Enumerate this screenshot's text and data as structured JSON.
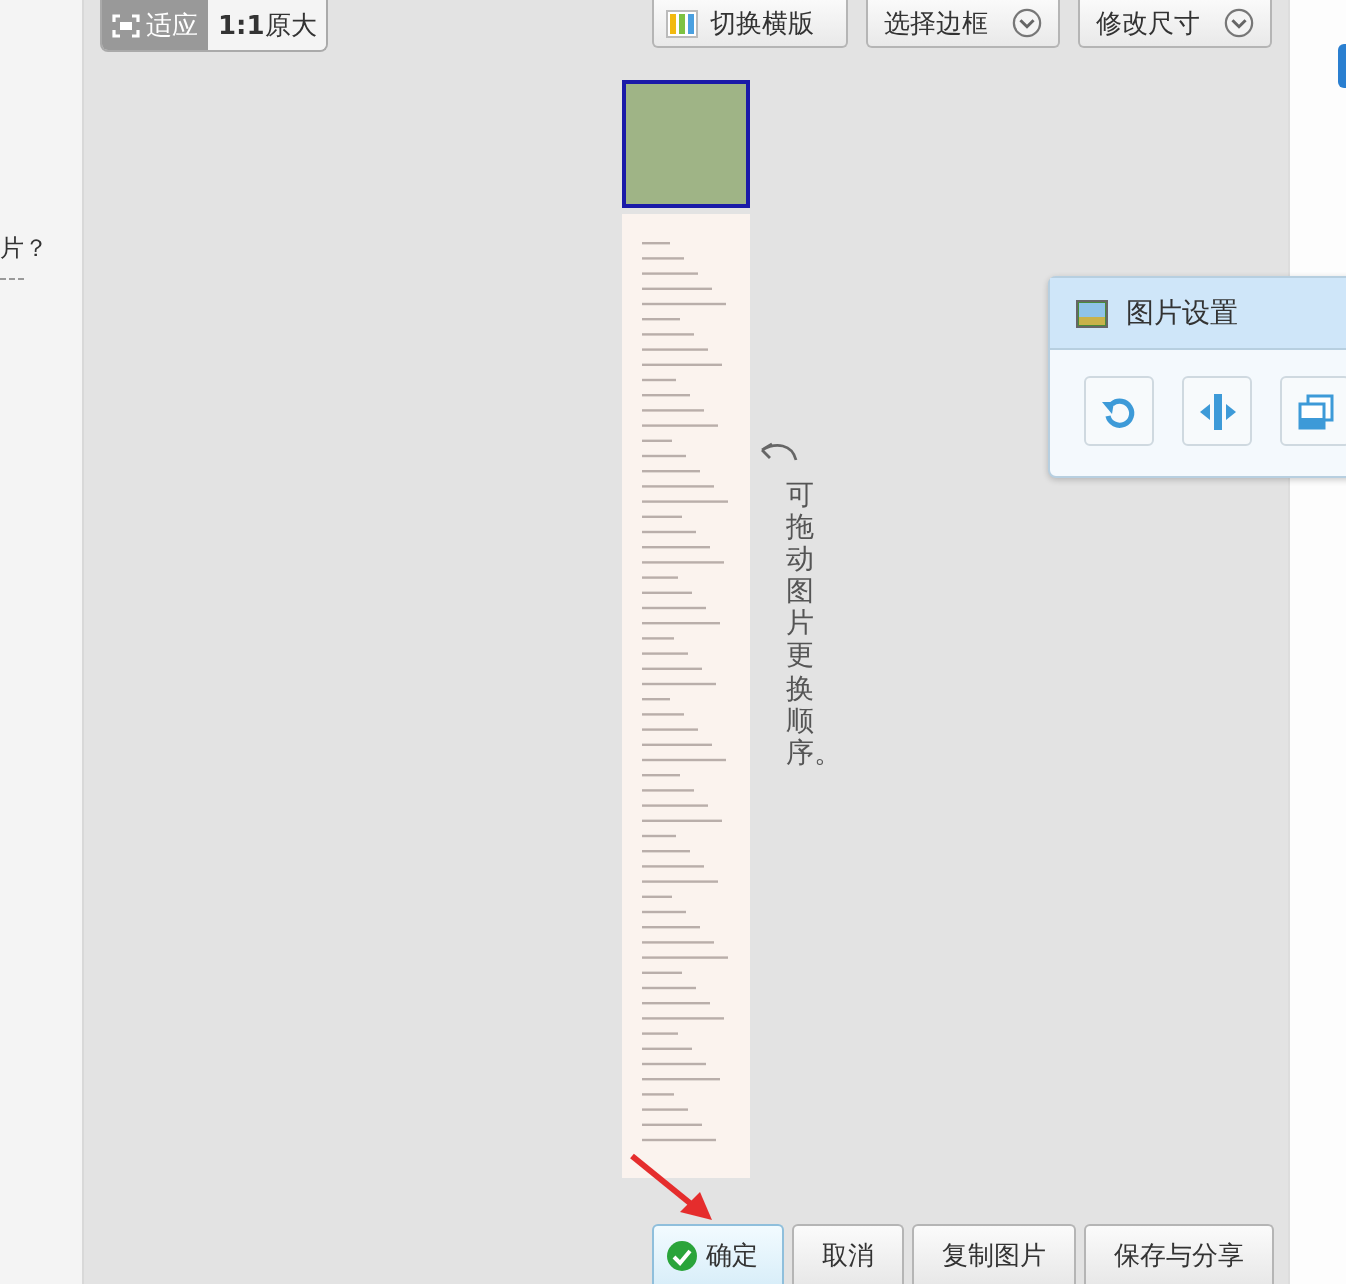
{
  "sidebar": {
    "text": "片？"
  },
  "view_toggle": [
    {
      "label": "适应",
      "kind": "fit",
      "selected": true
    },
    {
      "label": "**1:1**原大",
      "kind": "actual",
      "selected": false
    }
  ],
  "toolbar_buttons": [
    {
      "label": "切换横版",
      "kind": "layout"
    },
    {
      "label": "选择边框",
      "kind": "dropdown"
    },
    {
      "label": "修改尺寸",
      "kind": "dropdown"
    }
  ],
  "thumbnails": [
    {
      "kind": "photo",
      "selected": true
    },
    {
      "kind": "document",
      "selected": false
    }
  ],
  "annotation": {
    "text": "可拖动图片更换顺序。"
  },
  "settings_panel": {
    "title": "图片设置"
  },
  "actions": [
    {
      "label": "确定",
      "kind": "confirm"
    },
    {
      "label": "取消",
      "kind": "plain"
    },
    {
      "label": "复制图片",
      "kind": "plain"
    },
    {
      "label": "保存与分享",
      "kind": "plain"
    }
  ]
}
